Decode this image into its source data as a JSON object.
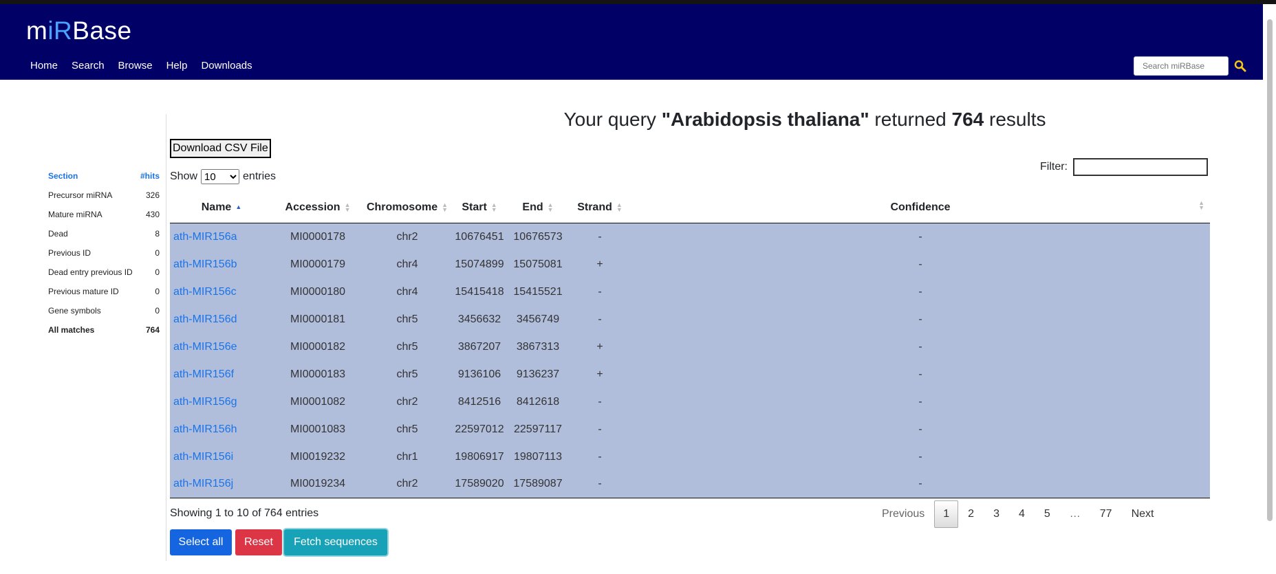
{
  "header": {
    "logo_prefix": "m",
    "logo_accent": "iR",
    "logo_suffix": "Base",
    "nav": [
      "Home",
      "Search",
      "Browse",
      "Help",
      "Downloads"
    ],
    "search_placeholder": "Search miRBase"
  },
  "sidebar": {
    "head_section": "Section",
    "head_hits": "#hits",
    "rows": [
      {
        "label": "Precursor miRNA",
        "hits": "326"
      },
      {
        "label": "Mature miRNA",
        "hits": "430"
      },
      {
        "label": "Dead",
        "hits": "8"
      },
      {
        "label": "Previous ID",
        "hits": "0"
      },
      {
        "label": "Dead entry previous ID",
        "hits": "0"
      },
      {
        "label": "Previous mature ID",
        "hits": "0"
      },
      {
        "label": "Gene symbols",
        "hits": "0"
      },
      {
        "label": "All matches",
        "hits": "764"
      }
    ]
  },
  "main": {
    "title_pre": "Your query ",
    "title_query": "\"Arabidopsis thaliana\"",
    "title_mid": " returned ",
    "title_count": "764",
    "title_post": " results",
    "csv_button": "Download CSV File",
    "show_label": "Show",
    "show_value": "10",
    "entries_label": "entries",
    "filter_label": "Filter:",
    "columns": [
      "Name",
      "Accession",
      "Chromosome",
      "Start",
      "End",
      "Strand",
      "Confidence"
    ],
    "rows": [
      [
        "ath-MIR156a",
        "MI0000178",
        "chr2",
        "10676451",
        "10676573",
        "-",
        "-"
      ],
      [
        "ath-MIR156b",
        "MI0000179",
        "chr4",
        "15074899",
        "15075081",
        "+",
        "-"
      ],
      [
        "ath-MIR156c",
        "MI0000180",
        "chr4",
        "15415418",
        "15415521",
        "-",
        "-"
      ],
      [
        "ath-MIR156d",
        "MI0000181",
        "chr5",
        "3456632",
        "3456749",
        "-",
        "-"
      ],
      [
        "ath-MIR156e",
        "MI0000182",
        "chr5",
        "3867207",
        "3867313",
        "+",
        "-"
      ],
      [
        "ath-MIR156f",
        "MI0000183",
        "chr5",
        "9136106",
        "9136237",
        "+",
        "-"
      ],
      [
        "ath-MIR156g",
        "MI0001082",
        "chr2",
        "8412516",
        "8412618",
        "-",
        "-"
      ],
      [
        "ath-MIR156h",
        "MI0001083",
        "chr5",
        "22597012",
        "22597117",
        "-",
        "-"
      ],
      [
        "ath-MIR156i",
        "MI0019232",
        "chr1",
        "19806917",
        "19807113",
        "-",
        "-"
      ],
      [
        "ath-MIR156j",
        "MI0019234",
        "chr2",
        "17589020",
        "17589087",
        "-",
        "-"
      ]
    ],
    "info": "Showing 1 to 10 of 764 entries",
    "pager": {
      "previous": "Previous",
      "pages": [
        "1",
        "2",
        "3",
        "4",
        "5"
      ],
      "ellipsis": "…",
      "last": "77",
      "next": "Next"
    },
    "buttons": {
      "select_all": "Select all",
      "reset": "Reset",
      "fetch": "Fetch sequences"
    }
  },
  "colors": {
    "header_bg": "#000066",
    "row_bg": "#b0bedc",
    "link": "#1a73e8",
    "btn_primary": "#1565e0",
    "btn_danger": "#dc3545",
    "btn_info": "#17a2b8"
  }
}
